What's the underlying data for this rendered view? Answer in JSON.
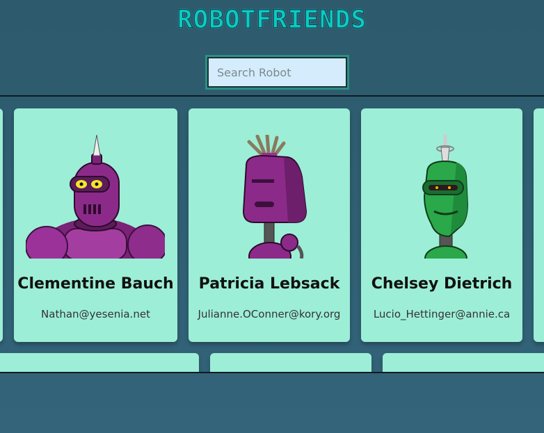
{
  "app": {
    "title": "ROBOTFRIENDS"
  },
  "search": {
    "placeholder": "Search Robot",
    "value": ""
  },
  "robots": [
    {
      "name": "Clementine Bauch",
      "email": "Nathan@yesenia.net",
      "color": "#8e2a8c",
      "icon": "purple-robot"
    },
    {
      "name": "Patricia Lebsack",
      "email": "Julianne.OConner@kory.org",
      "color": "#8e2a8c",
      "icon": "purple-robot-antenna"
    },
    {
      "name": "Chelsey Dietrich",
      "email": "Lucio_Hettinger@annie.ca",
      "color": "#2aa84a",
      "icon": "green-robot"
    }
  ],
  "colors": {
    "card": "#9deed6",
    "title": "#0ccac4",
    "background": "#2d5a6c"
  }
}
